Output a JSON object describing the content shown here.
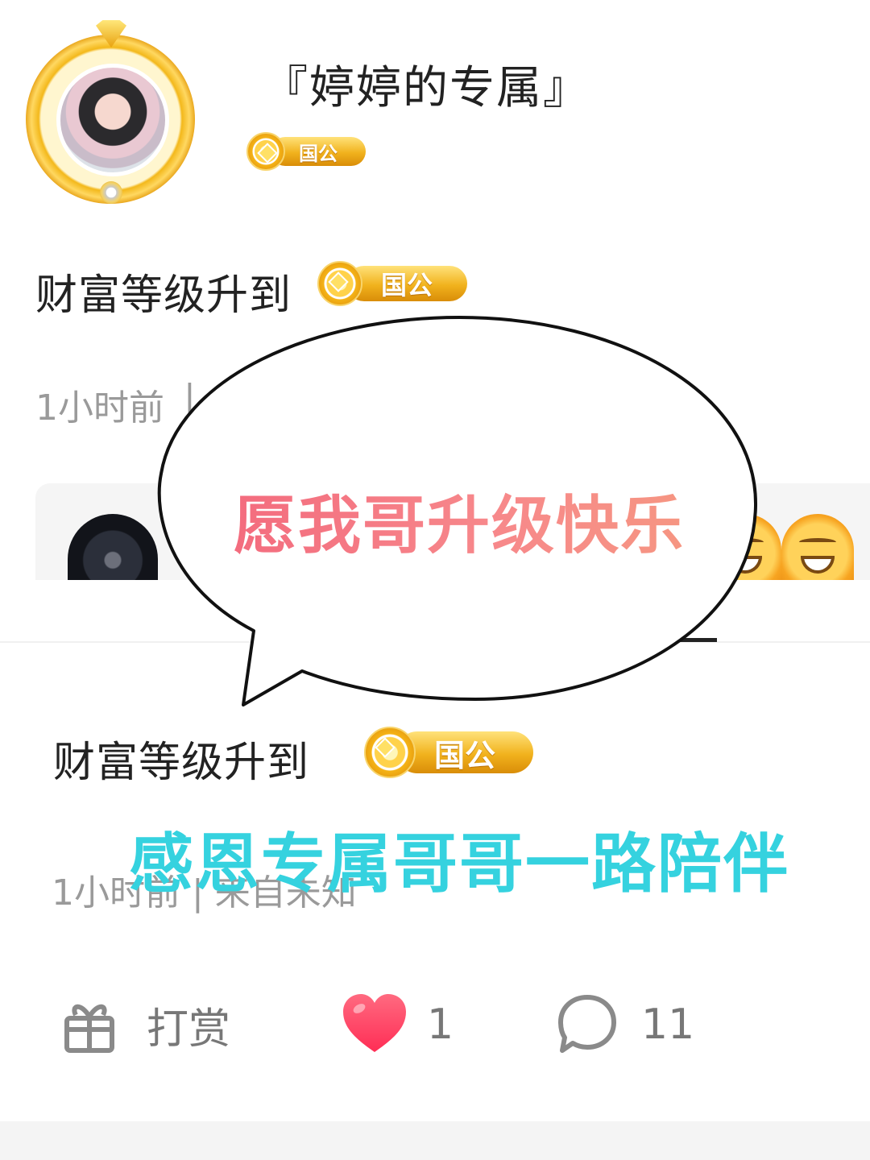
{
  "profile": {
    "username": "『婷婷的专属』",
    "badge_label": "国公"
  },
  "post_one": {
    "level_text": "财富等级升到",
    "badge_label": "国公",
    "meta_time": "1小时前",
    "meta_separator": "|"
  },
  "bubble": {
    "text": "愿我哥升级快乐"
  },
  "post_two": {
    "level_text": "财富等级升到",
    "badge_label": "国公",
    "meta": "1小时前 | 来自未知"
  },
  "caption": {
    "text": "感恩专属哥哥一路陪伴"
  },
  "actions": {
    "reward_label": "打赏",
    "like_count": "1",
    "comment_count": "11"
  },
  "icons": [
    "gift-icon",
    "heart-icon",
    "comment-icon",
    "grin-emoji-icon"
  ],
  "colors": {
    "badge_gold": "#f1b21d",
    "bubble_text_pink": "#f2637a",
    "caption_cyan": "#35d2df",
    "heart_red": "#ff3b5c"
  }
}
